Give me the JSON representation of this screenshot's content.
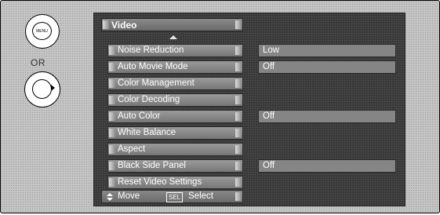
{
  "remote": {
    "menu_button_label": "MENU",
    "or_label": "OR"
  },
  "menu": {
    "title": "Video",
    "items": [
      {
        "label": "Noise Reduction",
        "value": "Low"
      },
      {
        "label": "Auto Movie Mode",
        "value": "Off"
      },
      {
        "label": "Color Management",
        "value": ""
      },
      {
        "label": "Color Decoding",
        "value": ""
      },
      {
        "label": "Auto Color",
        "value": "Off"
      },
      {
        "label": "White Balance",
        "value": ""
      },
      {
        "label": "Aspect",
        "value": ""
      },
      {
        "label": "Black Side Panel",
        "value": "Off"
      },
      {
        "label": "Reset Video Settings",
        "value": ""
      }
    ]
  },
  "footer": {
    "move_label": "Move",
    "select_key": "SEL",
    "select_label": "Select"
  }
}
